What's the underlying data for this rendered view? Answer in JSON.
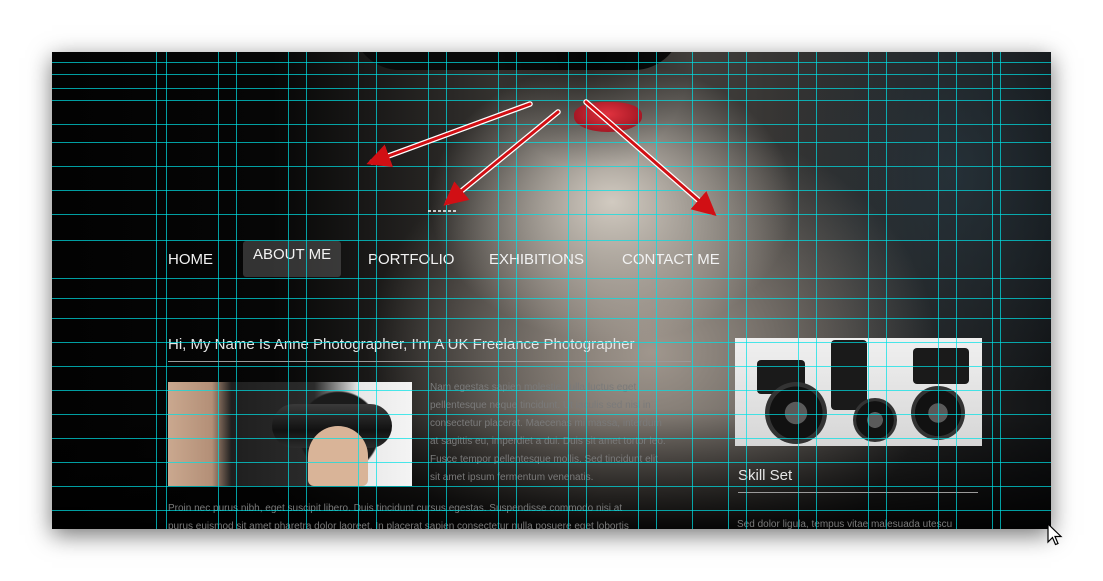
{
  "nav": {
    "items": [
      {
        "label": "HOME",
        "active": false
      },
      {
        "label": "ABOUT ME",
        "active": true
      },
      {
        "label": "PORTFOLIO",
        "active": false
      },
      {
        "label": "EXHIBITIONS",
        "active": false
      },
      {
        "label": "CONTACT ME",
        "active": false
      }
    ]
  },
  "main": {
    "title": "Hi, My Name Is Anne Photographer, I'm A UK Freelance Photographer",
    "intro_lines": [
      "Nam egestas sapien molestie nulla luctus eget",
      "pellentesque neque tincidunt. Ut iaculis sed nisl in",
      "consectetur placerat. Maecenas mi massa, interdum",
      "at sagittis eu, imperdiet a dui. Duis sit amet tortor leo.",
      "Fusce tempor pellentesque mollis. Sed tincidunt elit",
      "sit amet ipsum fermentum venenatis."
    ],
    "body_lines": [
      "Proin nec purus nibh, eget suscipit libero. Duis tincidunt cursus egestas. Suspendisse commodo nisi at",
      "purus euismod sit amet pharetra dolor laoreet. In placerat sapien consectetur nulla posuere eget lobortis"
    ]
  },
  "sidebar": {
    "heading": "Skill Set",
    "text": "Sed dolor ligula, tempus vitae malesuada utescu"
  },
  "colors": {
    "guide": "#00e1e6",
    "arrow": "#d10f14",
    "nav_text": "#f2f2f2",
    "body_text": "#7a7a7a"
  },
  "icons": {
    "cursor": "mouse-pointer-icon",
    "arrows": "red-arrow-annotation"
  }
}
